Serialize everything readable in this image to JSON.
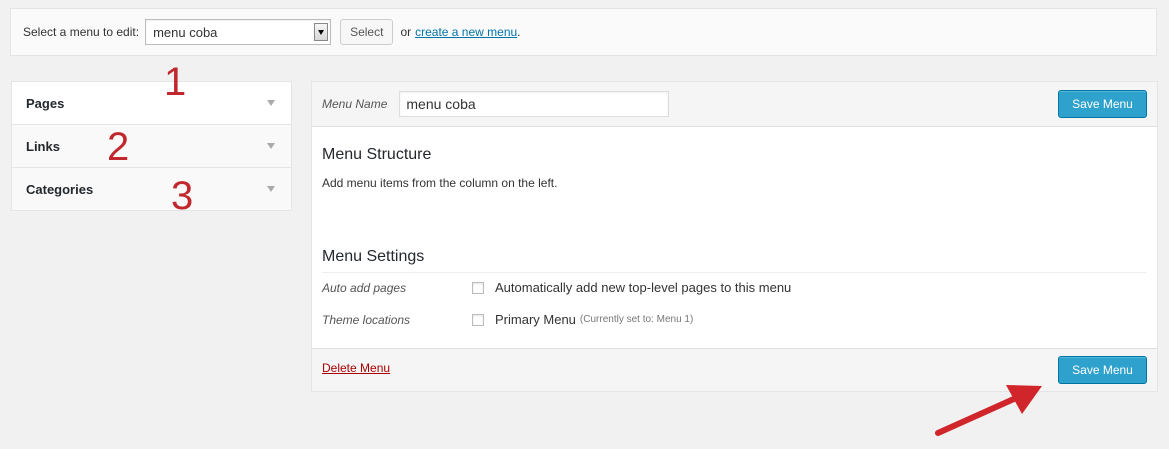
{
  "top_bar": {
    "label": "Select a menu to edit:",
    "selected_menu": "menu coba",
    "select_button": "Select",
    "or_text": "or",
    "create_link": "create a new menu",
    "period": "."
  },
  "left_panel": {
    "items": [
      {
        "label": "Pages"
      },
      {
        "label": "Links"
      },
      {
        "label": "Categories"
      }
    ]
  },
  "annotations": {
    "numbers": [
      "1",
      "2",
      "3"
    ],
    "arrow_color": "#d0262b"
  },
  "menu_panel": {
    "name_label": "Menu Name",
    "name_value": "menu coba",
    "save_label": "Save Menu",
    "structure_title": "Menu Structure",
    "structure_hint": "Add menu items from the column on the left.",
    "settings_title": "Menu Settings",
    "auto_add_label": "Auto add pages",
    "auto_add_text": "Automatically add new top-level pages to this menu",
    "theme_locations_label": "Theme locations",
    "primary_menu_text": "Primary Menu",
    "primary_menu_note": "(Currently set to: Menu 1)",
    "delete_label": "Delete Menu"
  },
  "colors": {
    "accent_blue": "#2ea2cc",
    "link_blue": "#0073aa",
    "delete_red": "#aa0000",
    "annotation_red": "#c0282d"
  }
}
